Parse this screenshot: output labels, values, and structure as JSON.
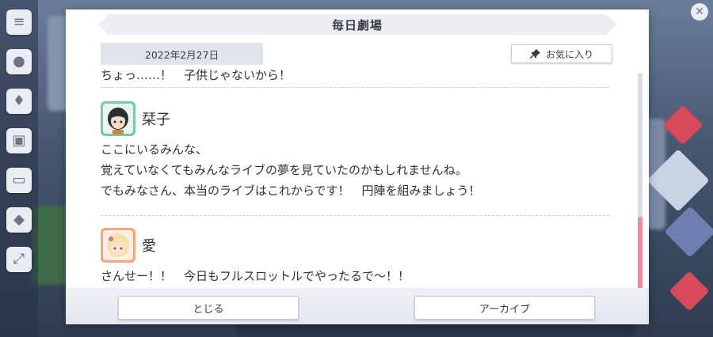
{
  "dialog": {
    "title": "毎日劇場",
    "date": "2022年2月27日",
    "favorite_label": "お気に入り"
  },
  "messages": {
    "cut_line": "ちょっ……！　子供じゃないから！",
    "entries": [
      {
        "speaker": "栞子",
        "lines": [
          "ここにいるみんな、",
          "覚えていなくてもみんなライブの夢を見ていたのかもしれませんね。",
          "でもみなさん、本当のライブはこれからです！　円陣を組みましょう！"
        ]
      },
      {
        "speaker": "愛",
        "lines": [
          "さんせー！！　今日もフルスロットルでやったるで〜！！"
        ]
      }
    ]
  },
  "footer": {
    "close_label": "とじる",
    "archive_label": "アーカイブ"
  },
  "colors": {
    "scroll_thumb": "#e88a97",
    "avatar_shioriko_bg": "#7fc9a8",
    "avatar_ai_bg": "#f2a77a"
  },
  "icons": {
    "favorite": "pin-icon",
    "left_menu": [
      "menu-icon",
      "chat-icon",
      "trophy-icon",
      "gift-icon",
      "screen-icon",
      "cup-icon",
      "expand-icon"
    ]
  }
}
